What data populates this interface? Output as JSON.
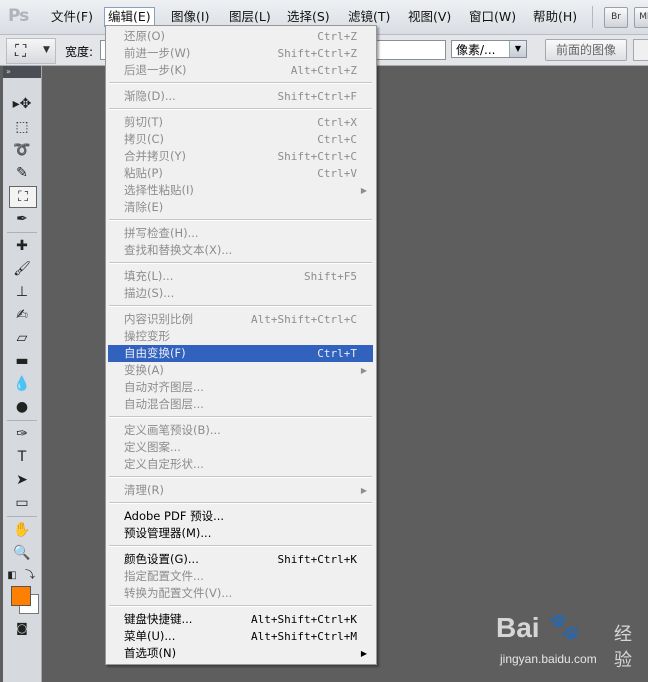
{
  "app": {
    "logo": "Ps"
  },
  "menubar": {
    "items": [
      "文件(F)",
      "编辑(E)",
      "图像(I)",
      "图层(L)",
      "选择(S)",
      "滤镜(T)",
      "视图(V)",
      "窗口(W)",
      "帮助(H)"
    ],
    "active": "编辑(E)",
    "bridge_button": "Br",
    "minibridge_button": "Mb"
  },
  "options_bar": {
    "tool_icon": "crop-icon",
    "width_label": "宽度:",
    "unit_select": "像素/...",
    "front_image_button": "前面的图像"
  },
  "toolbar": {
    "header": "»",
    "fg_color": "#ff8000",
    "bg_color": "#ffffff"
  },
  "edit_menu": {
    "items": [
      {
        "label": "还原(O)",
        "shortcut": "Ctrl+Z"
      },
      {
        "label": "前进一步(W)",
        "shortcut": "Shift+Ctrl+Z"
      },
      {
        "label": "后退一步(K)",
        "shortcut": "Alt+Ctrl+Z"
      },
      {
        "label": "渐隐(D)...",
        "shortcut": "Shift+Ctrl+F"
      },
      {
        "label": "剪切(T)",
        "shortcut": "Ctrl+X"
      },
      {
        "label": "拷贝(C)",
        "shortcut": "Ctrl+C"
      },
      {
        "label": "合并拷贝(Y)",
        "shortcut": "Shift+Ctrl+C"
      },
      {
        "label": "粘贴(P)",
        "shortcut": "Ctrl+V"
      },
      {
        "label": "选择性粘贴(I)",
        "shortcut": ""
      },
      {
        "label": "清除(E)",
        "shortcut": ""
      },
      {
        "label": "拼写检查(H)...",
        "shortcut": ""
      },
      {
        "label": "查找和替换文本(X)...",
        "shortcut": ""
      },
      {
        "label": "填充(L)...",
        "shortcut": "Shift+F5"
      },
      {
        "label": "描边(S)...",
        "shortcut": ""
      },
      {
        "label": "内容识别比例",
        "shortcut": "Alt+Shift+Ctrl+C"
      },
      {
        "label": "操控变形",
        "shortcut": ""
      },
      {
        "label": "自由变换(F)",
        "shortcut": "Ctrl+T"
      },
      {
        "label": "变换(A)",
        "shortcut": ""
      },
      {
        "label": "自动对齐图层...",
        "shortcut": ""
      },
      {
        "label": "自动混合图层...",
        "shortcut": ""
      },
      {
        "label": "定义画笔预设(B)...",
        "shortcut": ""
      },
      {
        "label": "定义图案...",
        "shortcut": ""
      },
      {
        "label": "定义自定形状...",
        "shortcut": ""
      },
      {
        "label": "清理(R)",
        "shortcut": ""
      },
      {
        "label": "Adobe PDF 预设...",
        "shortcut": ""
      },
      {
        "label": "预设管理器(M)...",
        "shortcut": ""
      },
      {
        "label": "颜色设置(G)...",
        "shortcut": "Shift+Ctrl+K"
      },
      {
        "label": "指定配置文件...",
        "shortcut": ""
      },
      {
        "label": "转换为配置文件(V)...",
        "shortcut": ""
      },
      {
        "label": "键盘快捷键...",
        "shortcut": "Alt+Shift+Ctrl+K"
      },
      {
        "label": "菜单(U)...",
        "shortcut": "Alt+Shift+Ctrl+M"
      },
      {
        "label": "首选项(N)",
        "shortcut": ""
      }
    ]
  },
  "watermark": {
    "brand": "Bai",
    "brand2": "经验",
    "url": "jingyan.baidu.com"
  }
}
